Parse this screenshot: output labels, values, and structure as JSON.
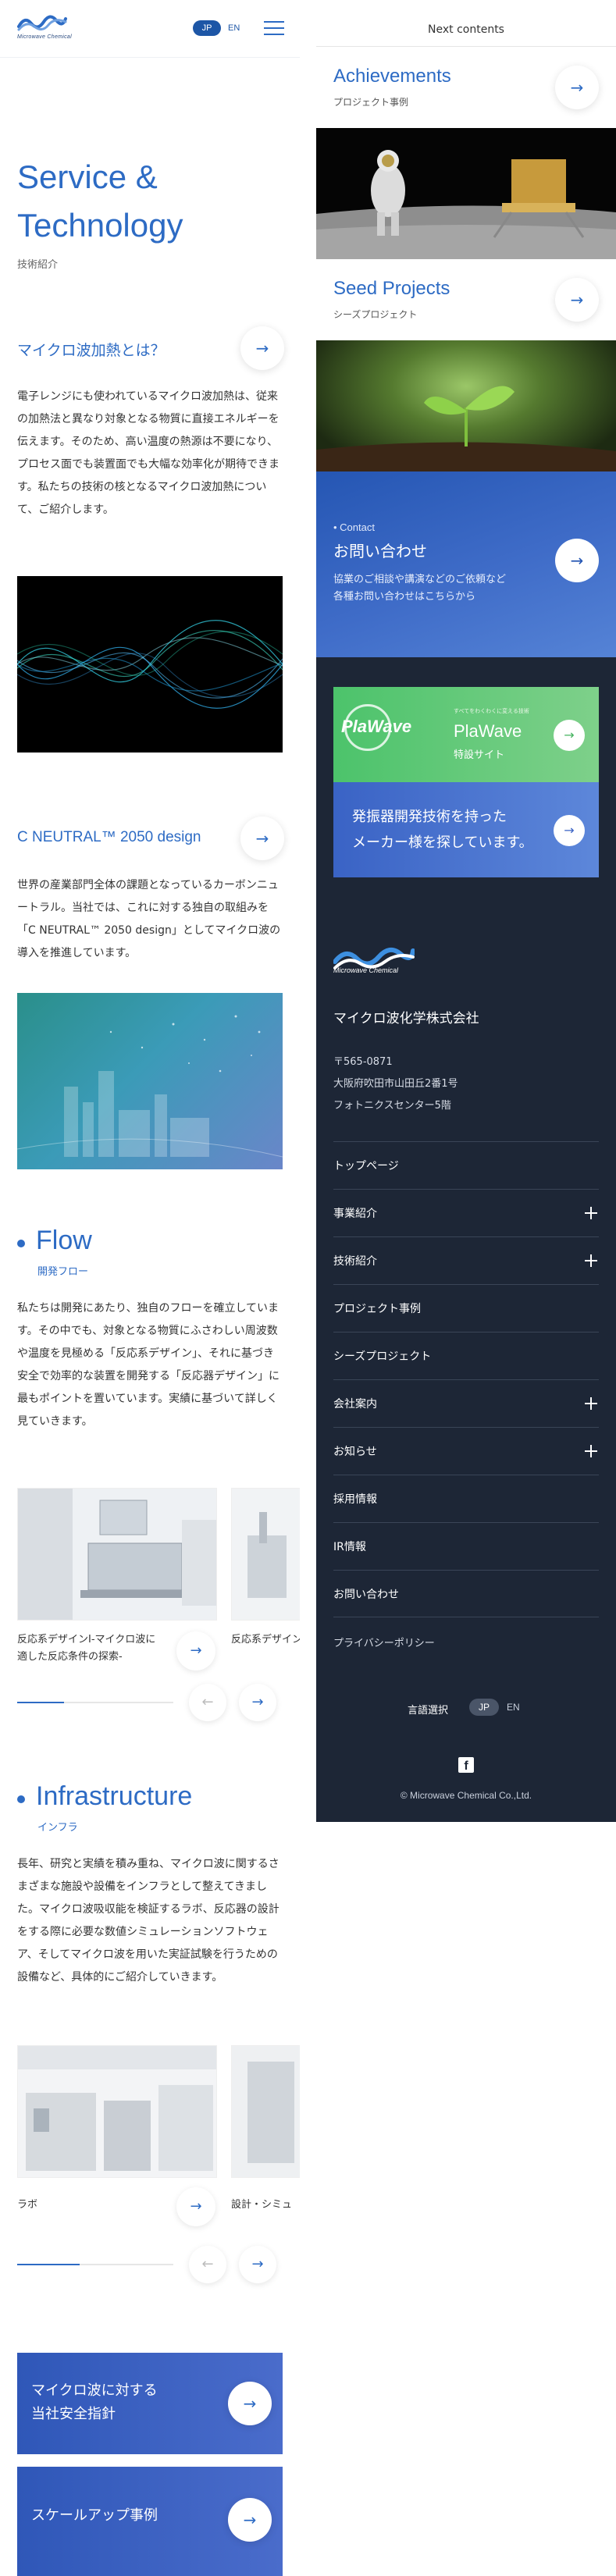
{
  "header": {
    "logo_text": "Microwave Chemical",
    "lang_jp": "JP",
    "lang_en": "EN"
  },
  "page": {
    "title_line1": "Service &",
    "title_line2": "Technology",
    "subtitle": "技術紹介"
  },
  "sections": {
    "microwave": {
      "title": "マイクロ波加熱とは？",
      "body": "電子レンジにも使われているマイクロ波加熱は、従来の加熱法と異なり対象となる物質に直接エネルギーを伝えます。そのため、高い温度の熱源は不要になり、プロセス面でも装置面でも大幅な効率化が期待できます。私たちの技術の核となるマイクロ波加熱について、ご紹介します。"
    },
    "cneutral": {
      "title": "C NEUTRAL™ 2050 design",
      "body": "世界の産業部門全体の課題となっているカーボンニュートラル。当社では、これに対する独自の取組みを「C NEUTRAL™ 2050 design」としてマイクロ波の導入を推進しています。"
    },
    "flow": {
      "title": "Flow",
      "subtitle": "開発フロー",
      "body": "私たちは開発にあたり、独自のフローを確立しています。その中でも、対象となる物質にふさわしい周波数や温度を見極める「反応系デザイン」、それに基づき安全で効率的な装置を開発する「反応器デザイン」に最もポイントを置いています。実績に基づいて詳しく見ていきます。",
      "cards": [
        {
          "caption": "反応系デザインⅠ-マイクロ波に適した反応条件の探索-"
        },
        {
          "caption": "反応系デザインⅡ-ラボ検証-"
        }
      ],
      "progress": 0.3
    },
    "infrastructure": {
      "title": "Infrastructure",
      "subtitle": "インフラ",
      "body": "長年、研究と実績を積み重ね、マイクロ波に関するさまざまな施設や設備をインフラとして整えてきました。マイクロ波吸収能を検証するラボ、反応器の設計をする際に必要な数値シミュレーションソフトウェア、そしてマイクロ波を用いた実証試験を行うための設備など、具体的にご紹介していきます。",
      "cards": [
        {
          "caption": "ラボ"
        },
        {
          "caption": "設計・シミュ"
        }
      ],
      "progress": 0.4
    },
    "cta": {
      "safety": "マイクロ波に対する\n当社安全指針",
      "scaleup": "スケールアップ事例"
    }
  },
  "next": {
    "header": "Next contents",
    "items": [
      {
        "en": "Achievements",
        "ja": "プロジェクト事例"
      },
      {
        "en": "Seed Projects",
        "ja": "シーズプロジェクト"
      }
    ]
  },
  "contact": {
    "label": "Contact",
    "title": "お問い合わせ",
    "desc": "協業のご相談や講演などのご依頼など\n各種お問い合わせはこちらから"
  },
  "banners": {
    "plawave_logo": "PlaWave",
    "plawave_tag": "すべてをわくわくに変える技術",
    "plawave_name": "PlaWave",
    "plawave_sub": "特設サイト",
    "recruit": "発振器開発技術を持った\nメーカー様を探しています。"
  },
  "footer": {
    "logo_text": "Microwave Chemical",
    "company": "マイクロ波化学株式会社",
    "address": "〒565-0871\n大阪府吹田市山田丘2番1号\nフォトニクスセンター5階",
    "nav": [
      {
        "label": "トップページ",
        "expand": false
      },
      {
        "label": "事業紹介",
        "expand": true
      },
      {
        "label": "技術紹介",
        "expand": true
      },
      {
        "label": "プロジェクト事例",
        "expand": false
      },
      {
        "label": "シーズプロジェクト",
        "expand": false
      },
      {
        "label": "会社案内",
        "expand": true
      },
      {
        "label": "お知らせ",
        "expand": true
      },
      {
        "label": "採用情報",
        "expand": false
      },
      {
        "label": "IR情報",
        "expand": false
      },
      {
        "label": "お問い合わせ",
        "expand": false
      }
    ],
    "privacy": "プライバシーポリシー",
    "lang_label": "言語選択",
    "lang_jp": "JP",
    "lang_en": "EN",
    "copyright": "© Microwave Chemical Co.,Ltd."
  },
  "colors": {
    "accent": "#2d6bc4",
    "footer_bg": "#1d2636",
    "plawave_green": "#4cc36b"
  },
  "icons": [
    "arrow-right-icon",
    "arrow-left-icon",
    "menu-icon",
    "plus-icon",
    "facebook-icon"
  ]
}
